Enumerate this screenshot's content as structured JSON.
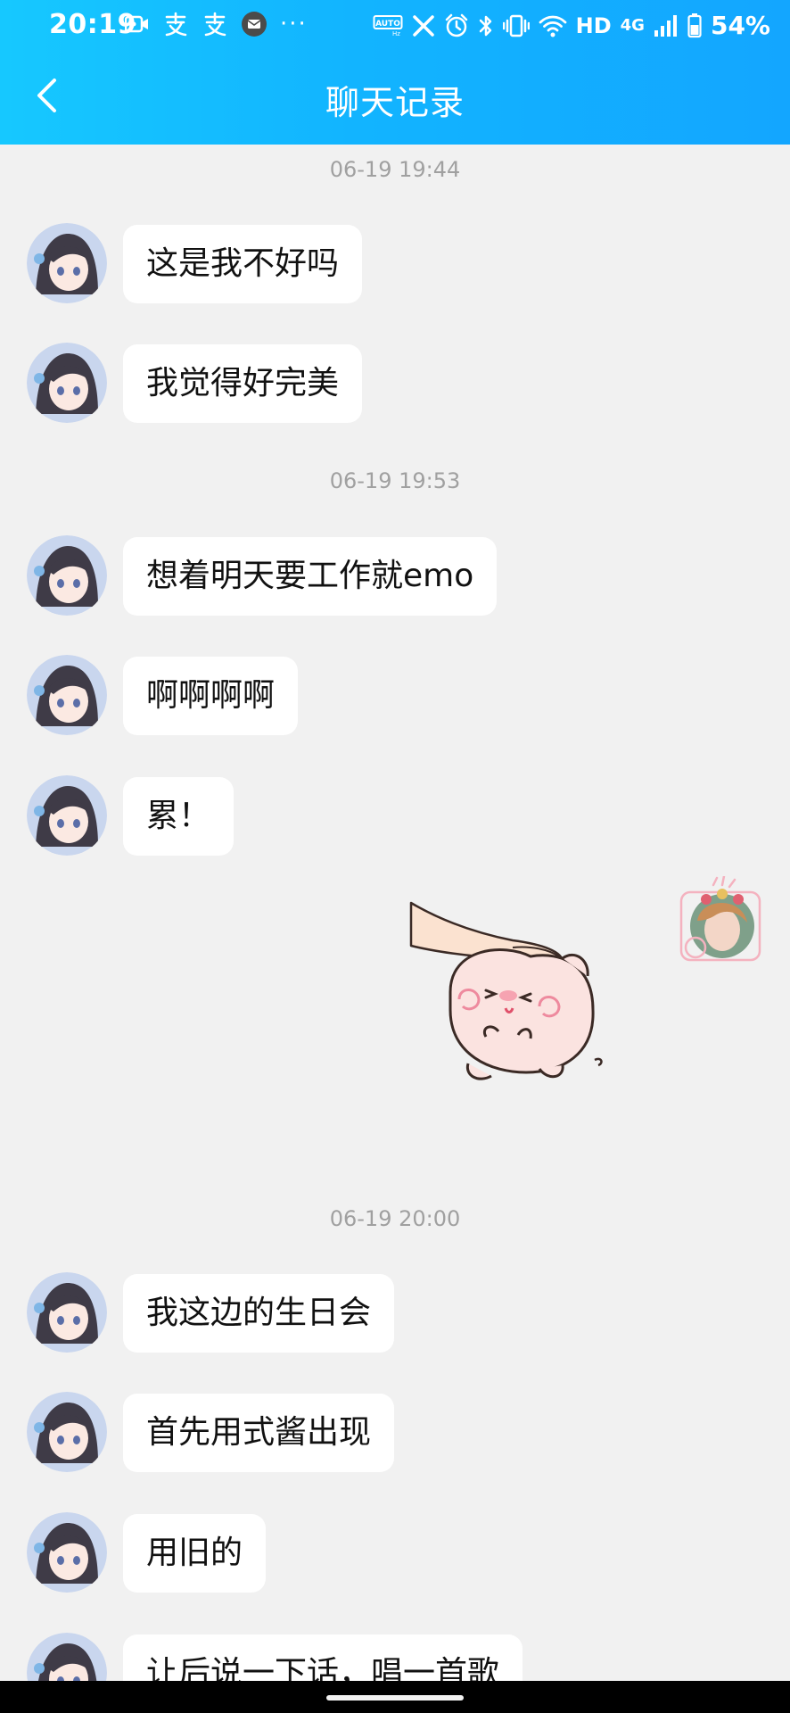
{
  "status_bar": {
    "time": "20:19",
    "hd": "HD",
    "network": "4G",
    "battery": "54%",
    "overflow": "···",
    "icons": [
      "video-icon",
      "alipay-icon",
      "alipay-icon",
      "mail-icon",
      "auto-icon",
      "x-icon",
      "alarm-icon",
      "bluetooth-icon",
      "vibrate-icon",
      "wifi-icon",
      "signal-icon",
      "battery-icon"
    ]
  },
  "header": {
    "title": "聊天记录",
    "back_icon": "chevron-left-icon",
    "background": "#13b6ff"
  },
  "chat": {
    "groups": [
      {
        "timestamp": "06-19 19:44",
        "messages": [
          "这是我不好吗",
          "我觉得好完美"
        ]
      },
      {
        "timestamp": "06-19 19:53",
        "messages": [
          "想着明天要工作就emo",
          "啊啊啊啊",
          "累！"
        ],
        "reply_sticker": "head-pat-pig-sticker"
      },
      {
        "timestamp": "06-19 20:00",
        "messages": [
          "我这边的生日会",
          "首先用式酱出现",
          "用旧的",
          "让后说一下话，唱一首歌"
        ]
      }
    ]
  }
}
